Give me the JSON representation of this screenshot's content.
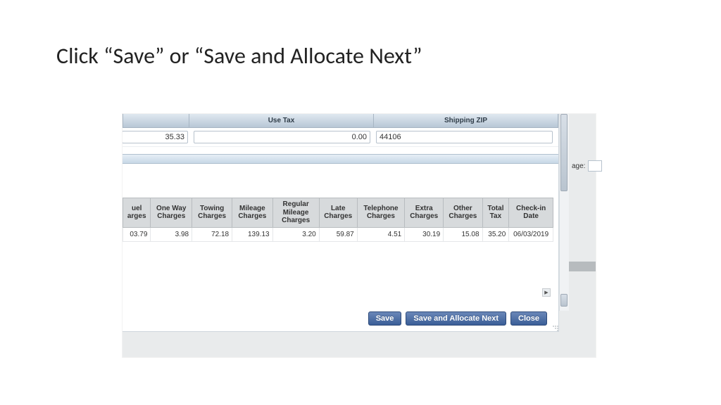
{
  "slide_title": "Click “Save” or “Save and Allocate Next”",
  "top": {
    "left_value": "35.33",
    "use_tax_header": "Use Tax",
    "use_tax_value": "0.00",
    "shipping_zip_header": "Shipping ZIP",
    "shipping_zip_value": "44106"
  },
  "grid": {
    "headers": [
      "uel arges",
      "One Way Charges",
      "Towing Charges",
      "Mileage Charges",
      "Regular Mileage Charges",
      "Late Charges",
      "Telephone Charges",
      "Extra Charges",
      "Other Charges",
      "Total Tax",
      "Check-in Date"
    ],
    "row": [
      "03.79",
      "3.98",
      "72.18",
      "139.13",
      "3.20",
      "59.87",
      "4.51",
      "30.19",
      "15.08",
      "35.20",
      "06/03/2019"
    ]
  },
  "buttons": {
    "save": "Save",
    "save_alloc": "Save and Allocate Next",
    "close": "Close"
  },
  "sidebar_fragment_label": "age:"
}
